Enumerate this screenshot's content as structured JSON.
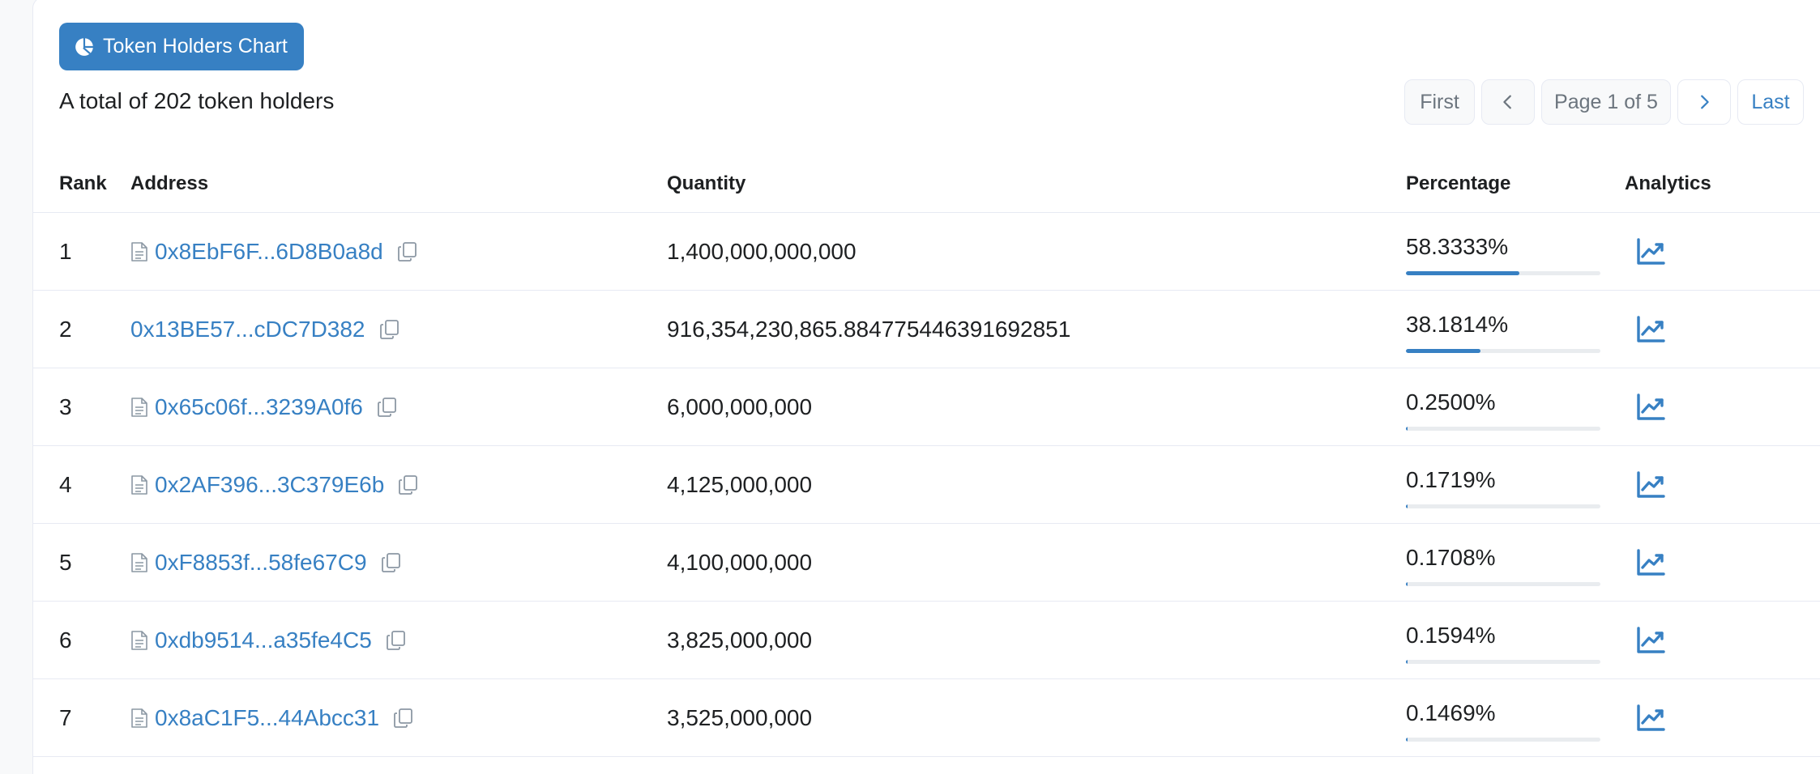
{
  "toolbar": {
    "chart_button_label": "Token Holders Chart"
  },
  "summary": {
    "total_text": "A total of 202 token holders"
  },
  "pagination": {
    "first_label": "First",
    "page_info": "Page 1 of 5",
    "last_label": "Last"
  },
  "table": {
    "headers": {
      "rank": "Rank",
      "address": "Address",
      "quantity": "Quantity",
      "percentage": "Percentage",
      "analytics": "Analytics"
    },
    "rows": [
      {
        "rank": "1",
        "address": "0x8EbF6F...6D8B0a8d",
        "is_contract": true,
        "quantity": "1,400,000,000,000",
        "percentage": "58.3333%",
        "share": 0.583333
      },
      {
        "rank": "2",
        "address": "0x13BE57...cDC7D382",
        "is_contract": false,
        "quantity": "916,354,230,865.884775446391692851",
        "percentage": "38.1814%",
        "share": 0.381814
      },
      {
        "rank": "3",
        "address": "0x65c06f...3239A0f6",
        "is_contract": true,
        "quantity": "6,000,000,000",
        "percentage": "0.2500%",
        "share": 0.0025
      },
      {
        "rank": "4",
        "address": "0x2AF396...3C379E6b",
        "is_contract": true,
        "quantity": "4,125,000,000",
        "percentage": "0.1719%",
        "share": 0.001719
      },
      {
        "rank": "5",
        "address": "0xF8853f...58fe67C9",
        "is_contract": true,
        "quantity": "4,100,000,000",
        "percentage": "0.1708%",
        "share": 0.001708
      },
      {
        "rank": "6",
        "address": "0xdb9514...a35fe4C5",
        "is_contract": true,
        "quantity": "3,825,000,000",
        "percentage": "0.1594%",
        "share": 0.001594
      },
      {
        "rank": "7",
        "address": "0x8aC1F5...44Abcc31",
        "is_contract": true,
        "quantity": "3,525,000,000",
        "percentage": "0.1469%",
        "share": 0.001469
      }
    ]
  },
  "colors": {
    "accent": "#3780c3",
    "bar_track": "#e9ecef",
    "border": "#e7eaf3"
  },
  "icons": {
    "chart_button": "pie-chart-icon",
    "contract": "document-icon",
    "copy": "copy-icon",
    "analytics": "line-chart-icon",
    "prev": "chevron-left-icon",
    "next": "chevron-right-icon"
  }
}
